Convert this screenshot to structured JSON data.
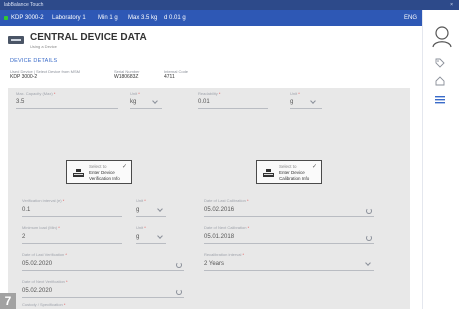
{
  "titlebar": {
    "app_name": "labBalance Touch",
    "close": "×"
  },
  "infobar": {
    "device": "KDP 3000-2",
    "lab": "Laboratory 1",
    "min": "Min 1 g",
    "max": "Max 3.5 kg",
    "d": "d 0.01 g",
    "language": "ENG"
  },
  "header": {
    "title": "CENTRAL DEVICE DATA",
    "subtitle": "Using a Device"
  },
  "device_details": {
    "heading": "DEVICE DETAILS",
    "label_type": "Used Device | Select Device from MSM",
    "type_value": "KDP 3000-2",
    "label_serial": "Serial Number",
    "serial_value": "W180683Z",
    "label_internal": "Internal Code",
    "internal_value": "4711",
    "label_max_capacity": "Max. Capacity (Max)",
    "max_capacity_value": "3.5",
    "label_unit_1": "Unit",
    "unit_1_value": "kg",
    "label_readability": "Readability",
    "readability_value": "0.01",
    "label_unit_2": "Unit",
    "unit_2_value": "g"
  },
  "cards": {
    "verification": {
      "select": "Select to",
      "line1": "Enter Device",
      "line2": "Verification Info"
    },
    "calibration": {
      "select": "Select to",
      "line1": "Enter Device",
      "line2": "Calibration Info"
    }
  },
  "verification": {
    "label_interval": "Verification interval (e)",
    "interval_value": "0.1",
    "label_unit_e": "Unit",
    "unit_e_value": "g",
    "label_min_load": "Minimum load (Min)",
    "min_load_value": "2",
    "label_unit_min": "Unit",
    "unit_min_value": "g",
    "label_last_verification": "Date of Last Verification",
    "last_verification_value": "05.02.2020",
    "label_next_verification": "Date of Next Verification",
    "next_verification_value": "05.02.2020",
    "label_bottom": "Custody / Specification"
  },
  "calibration": {
    "label_last": "Date of Last Calibration",
    "last_value": "05.02.2016",
    "label_next": "Date of Next Calibration",
    "next_value": "05.01.2018",
    "label_interval": "Recalibration interval",
    "interval_value": "2 Years"
  },
  "badge": {
    "number": "7"
  },
  "icons": {
    "user": "user-icon",
    "tag": "tag-icon",
    "home": "home-icon",
    "menu": "menu-icon",
    "device": "balance-device-icon",
    "check": "check-icon"
  },
  "colors": {
    "title_bar": "#2d4a8a",
    "info_bar": "#2e58b5",
    "accent": "#3a6bc9",
    "required": "#e04a4a",
    "section_bg": "#e8e8e8"
  }
}
